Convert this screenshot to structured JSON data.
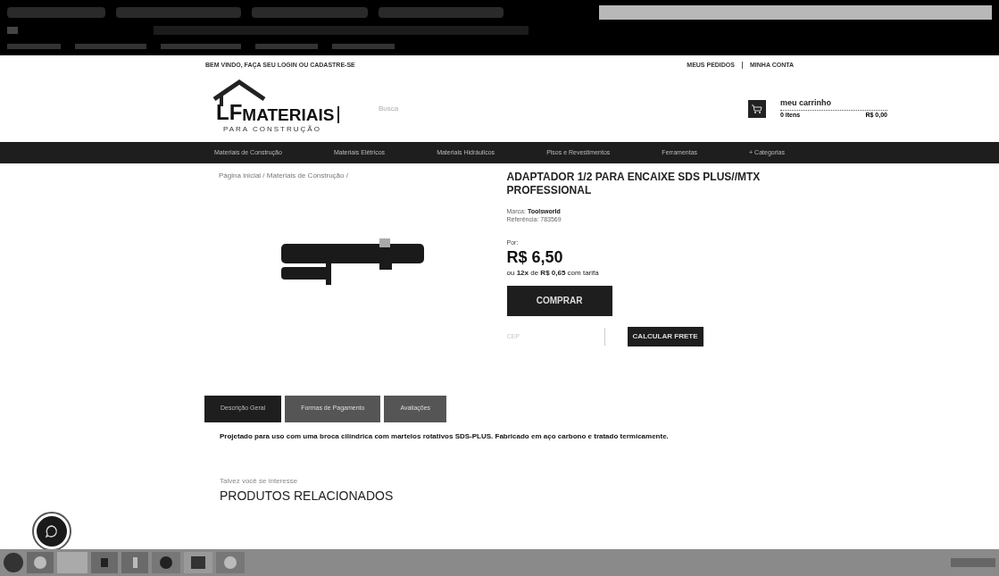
{
  "header": {
    "welcome": "BEM VINDO, FAÇA SEU LOGIN OU CADASTRE-SE",
    "links": [
      "MEUS PEDIDOS",
      "MINHA CONTA"
    ]
  },
  "logo": {
    "initials": "LF",
    "name": "MATERIAIS",
    "tagline": "PARA CONSTRUÇÃO"
  },
  "search": {
    "placeholder": "Busca"
  },
  "cart": {
    "title": "meu carrinho",
    "items": "0 itens",
    "total": "R$ 0,00"
  },
  "nav": [
    "Materiais de Construção",
    "Materiais Elétricos",
    "Materiais Hidráulicos",
    "Pisos e Revestimentos",
    "Ferramentas",
    "+ Categorias"
  ],
  "breadcrumb": "Página inicial / Materiais de Construção /",
  "product": {
    "title": "ADAPTADOR 1/2 PARA ENCAIXE SDS PLUS//MTX PROFESSIONAL",
    "brand_label": "Marca:",
    "brand": "Toolsworld",
    "ref_label": "Referência:",
    "ref": "783569",
    "price_label": "Por:",
    "price": "R$ 6,50",
    "installments": "ou **12x** de **R$ 0,65** com tarifa",
    "buy": "COMPRAR",
    "cep_placeholder": "CEP",
    "shipping": "CALCULAR FRETE"
  },
  "tabs": [
    {
      "label": "Descrição Geral",
      "selected": true
    },
    {
      "label": "Formas de Pagamento",
      "selected": false
    },
    {
      "label": "Avaliações",
      "selected": false
    }
  ],
  "description": "Projetado para uso com uma broca cilíndrica com martelos rotativos SDS-PLUS. Fabricado em aço carbono e tratado termicamente.",
  "related": {
    "subtitle": "Talvez você se interesse",
    "title": "PRODUTOS RELACIONADOS"
  }
}
